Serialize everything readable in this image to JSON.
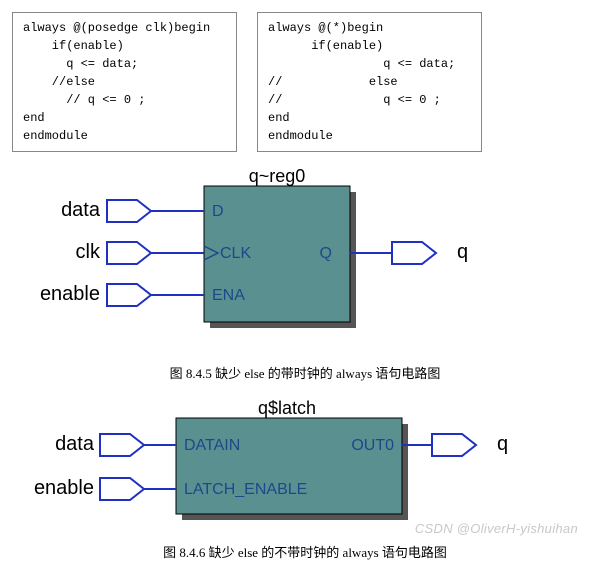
{
  "code_left": "always @(posedge clk)begin\n    if(enable)\n      q <= data;\n    //else\n      // q <= 0 ;\nend\nendmodule",
  "code_right": "always @(*)begin\n      if(enable)\n                q <= data;\n//            else\n//              q <= 0 ;\nend\nendmodule",
  "fig1": {
    "block_title": "q~reg0",
    "inputs": {
      "data": "data",
      "clk": "clk",
      "enable": "enable"
    },
    "pins": {
      "d": "D",
      "clk": "CLK",
      "ena": "ENA",
      "q": "Q"
    },
    "output": "q",
    "caption": "图  8.4.5  缺少 else 的带时钟的 always 语句电路图"
  },
  "fig2": {
    "block_title": "q$latch",
    "inputs": {
      "data": "data",
      "enable": "enable"
    },
    "pins": {
      "datain": "DATAIN",
      "latchen": "LATCH_ENABLE",
      "out": "OUT0"
    },
    "output": "q",
    "caption": "图  8.4.6  缺少 else 的不带时钟的 always 语句电路图"
  },
  "watermark": "CSDN @OliverH-yishuihan",
  "chart_data": [
    {
      "type": "diagram",
      "title": "q~reg0",
      "component": "D Flip-Flop (edge-triggered register)",
      "inputs": [
        {
          "port_label": "data",
          "pin": "D"
        },
        {
          "port_label": "clk",
          "pin": "CLK",
          "edge_triggered": true
        },
        {
          "port_label": "enable",
          "pin": "ENA"
        }
      ],
      "outputs": [
        {
          "pin": "Q",
          "port_label": "q"
        }
      ],
      "caption": "图 8.4.5 缺少 else 的带时钟的 always 语句电路图"
    },
    {
      "type": "diagram",
      "title": "q$latch",
      "component": "Latch (level-sensitive)",
      "inputs": [
        {
          "port_label": "data",
          "pin": "DATAIN"
        },
        {
          "port_label": "enable",
          "pin": "LATCH_ENABLE"
        }
      ],
      "outputs": [
        {
          "pin": "OUT0",
          "port_label": "q"
        }
      ],
      "caption": "图 8.4.6 缺少 else 的不带时钟的 always 语句电路图"
    }
  ]
}
